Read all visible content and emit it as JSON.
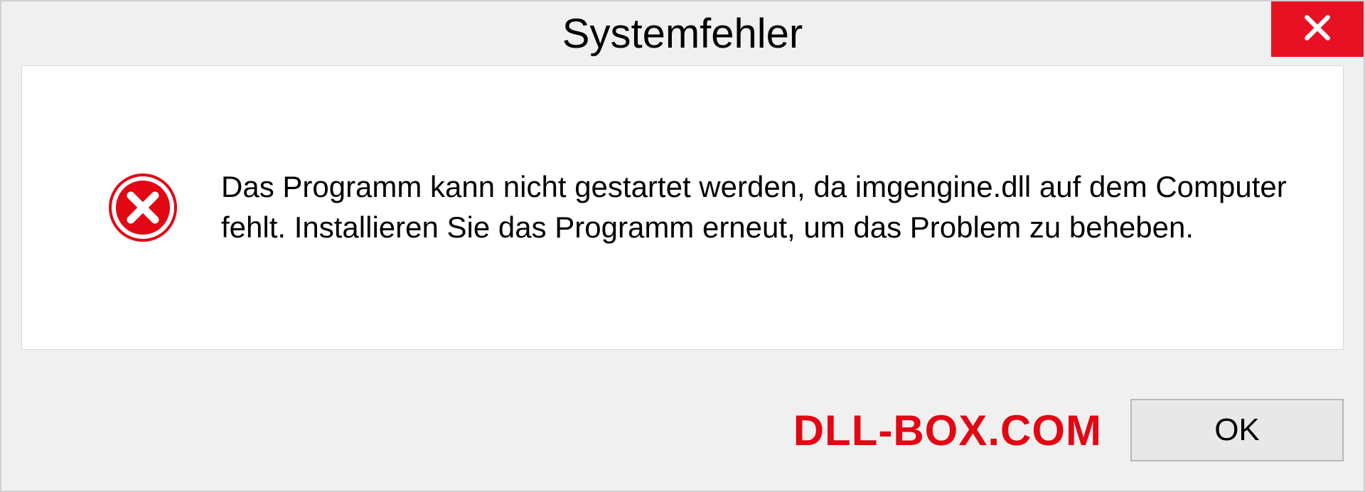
{
  "dialog": {
    "title": "Systemfehler",
    "message": "Das Programm kann nicht gestartet werden, da imgengine.dll auf dem Computer fehlt. Installieren Sie das Programm erneut, um das Problem zu beheben.",
    "ok_label": "OK"
  },
  "watermark": {
    "text": "DLL-BOX.COM"
  },
  "colors": {
    "close_button": "#e81123",
    "error_icon": "#e30613",
    "watermark": "#e30613"
  }
}
